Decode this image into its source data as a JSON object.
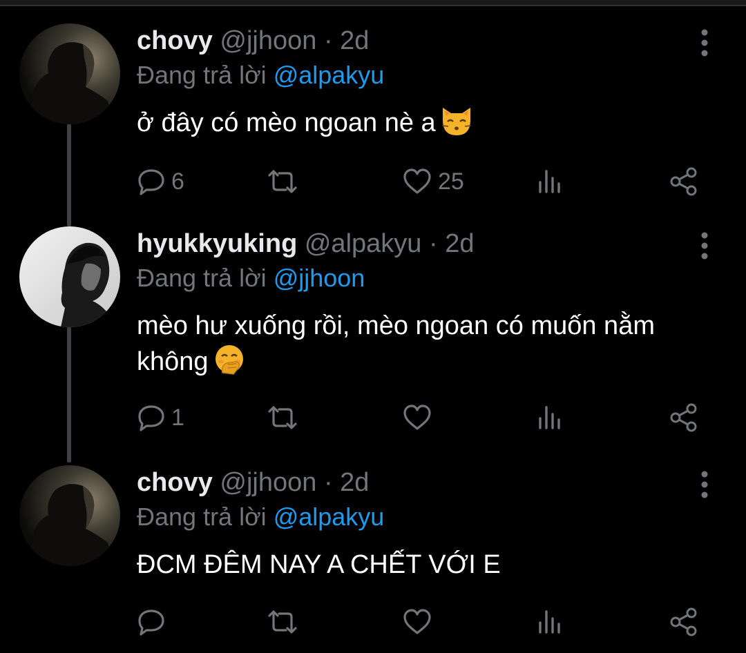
{
  "tweets": [
    {
      "display_name": "chovy",
      "handle": "@jjhoon",
      "separator": "·",
      "time": "2d",
      "replying_label": "Đang trả lời",
      "replying_to": "@alpakyu",
      "text": "ở đây có mèo ngoan nè a",
      "emoji": "kissing-cat-face",
      "counts": {
        "replies": "6",
        "retweets": "",
        "likes": "25"
      }
    },
    {
      "display_name": "hyukkyuking",
      "handle": "@alpakyu",
      "separator": "·",
      "time": "2d",
      "replying_label": "Đang trả lời",
      "replying_to": "@jjhoon",
      "text": "mèo hư xuống rồi, mèo ngoan có muốn nằm không",
      "emoji": "face-with-hand-over-mouth",
      "counts": {
        "replies": "1",
        "retweets": "",
        "likes": ""
      }
    },
    {
      "display_name": "chovy",
      "handle": "@jjhoon",
      "separator": "·",
      "time": "2d",
      "replying_label": "Đang trả lời",
      "replying_to": "@alpakyu",
      "text": "ĐCM ĐÊM NAY A CHẾT VỚI E",
      "emoji": "",
      "counts": {
        "replies": "",
        "retweets": "",
        "likes": ""
      }
    }
  ],
  "icons": [
    "more-vertical-icon",
    "reply-icon",
    "retweet-icon",
    "like-icon",
    "stats-icon",
    "share-icon"
  ],
  "colors": {
    "background": "#000000",
    "name": "#e7e9ea",
    "muted": "#71767b",
    "mention": "#1d9bf0",
    "thread_line": "#3e4144"
  }
}
